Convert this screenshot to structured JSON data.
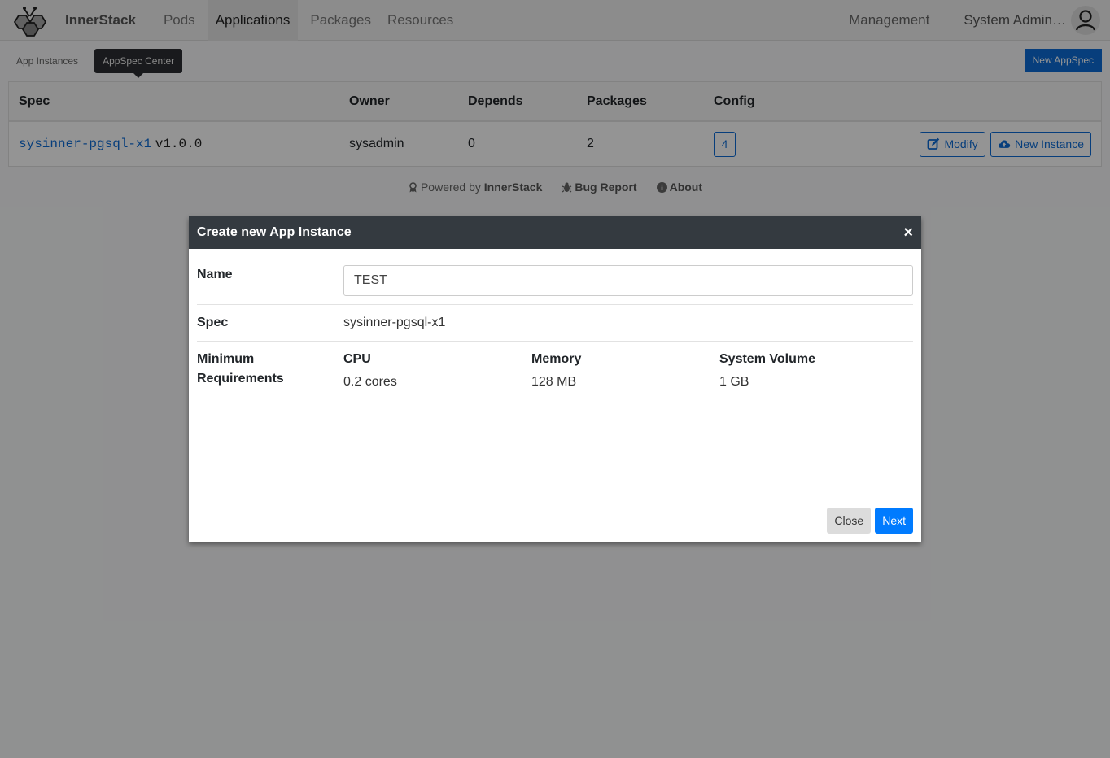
{
  "topnav": {
    "brand": "InnerStack",
    "items": [
      {
        "label": "Pods",
        "active": false
      },
      {
        "label": "Applications",
        "active": true
      },
      {
        "label": "Packages",
        "active": false
      },
      {
        "label": "Resources",
        "active": false
      }
    ],
    "management": "Management",
    "user": "System Admin…"
  },
  "subnav": {
    "items": [
      {
        "label": "App Instances",
        "active": false
      },
      {
        "label": "AppSpec Center",
        "active": true
      }
    ],
    "new_button": "New AppSpec"
  },
  "table": {
    "headers": [
      "Spec",
      "Owner",
      "Depends",
      "Packages",
      "Config"
    ],
    "rows": [
      {
        "spec_name": "sysinner-pgsql-x1",
        "spec_version": "v1.0.0",
        "owner": "sysadmin",
        "depends": "0",
        "packages": "2",
        "config": "4",
        "modify": "Modify",
        "new_instance": "New Instance"
      }
    ]
  },
  "footer": {
    "powered_prefix": "Powered by",
    "powered_brand": "InnerStack",
    "bug_report": "Bug Report",
    "about": "About"
  },
  "modal": {
    "title": "Create new App Instance",
    "close_icon": "×",
    "name_label": "Name",
    "name_value": "TEST",
    "spec_label": "Spec",
    "spec_value": "sysinner-pgsql-x1",
    "req_label": "Minimum Requirements",
    "requirements": [
      {
        "label": "CPU",
        "value": "0.2 cores"
      },
      {
        "label": "Memory",
        "value": "128 MB"
      },
      {
        "label": "System Volume",
        "value": "1 GB"
      }
    ],
    "close_button": "Close",
    "next_button": "Next"
  },
  "colors": {
    "primary": "#007bff",
    "link": "#0d6cd6",
    "modal_header": "#343a40"
  }
}
